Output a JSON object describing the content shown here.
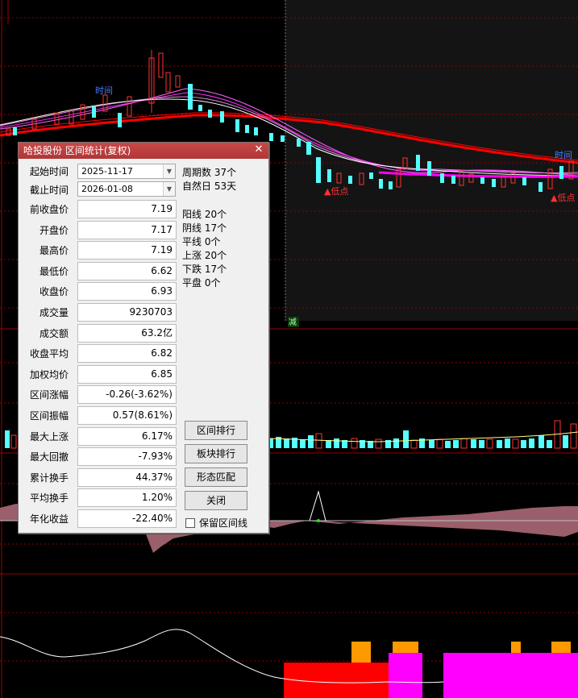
{
  "dialog": {
    "title": "哈投股份 区间统计(复权)",
    "start_label": "起始时间",
    "start_value": "2025-11-17",
    "end_label": "截止时间",
    "end_value": "2026-01-08",
    "rows": [
      {
        "label": "前收盘价",
        "value": "7.19"
      },
      {
        "label": "开盘价",
        "value": "7.17"
      },
      {
        "label": "最高价",
        "value": "7.19"
      },
      {
        "label": "最低价",
        "value": "6.62"
      },
      {
        "label": "收盘价",
        "value": "6.93"
      },
      {
        "label": "成交量",
        "value": "9230703"
      },
      {
        "label": "成交额",
        "value": "63.2亿"
      },
      {
        "label": "收盘平均",
        "value": "6.82"
      },
      {
        "label": "加权均价",
        "value": "6.85"
      },
      {
        "label": "区间涨幅",
        "value": "-0.26(-3.62%)"
      },
      {
        "label": "区间振幅",
        "value": "0.57(8.61%)"
      },
      {
        "label": "最大上涨",
        "value": "6.17%"
      },
      {
        "label": "最大回撤",
        "value": "-7.93%"
      },
      {
        "label": "累计换手",
        "value": "44.37%"
      },
      {
        "label": "平均换手",
        "value": "1.20%"
      },
      {
        "label": "年化收益",
        "value": "-22.40%"
      }
    ],
    "stats": {
      "period_count": "周期数 37个",
      "natural_days": "自然日 53天",
      "yang": "阳线 20个",
      "yin": "阴线 17个",
      "flat_line": "平线 0个",
      "up": "上涨 20个",
      "down": "下跌 17个",
      "flat": "平盘 0个"
    },
    "buttons": {
      "rank": "区间排行",
      "sector_rank": "板块排行",
      "pattern": "形态匹配",
      "close": "关闭"
    },
    "keep_lines_label": "保留区间线"
  },
  "chart": {
    "annotations": {
      "time1": "时间",
      "time2": "时间",
      "low1": "▲低点",
      "low2": "▲低点",
      "jian": "减"
    },
    "colors": {
      "up": "#ff3232",
      "down": "#54ffff",
      "ma_red": "#ff0000",
      "ma_pink": "#ff00ff",
      "grid": "#8b0000",
      "orange": "#ff9900"
    }
  }
}
